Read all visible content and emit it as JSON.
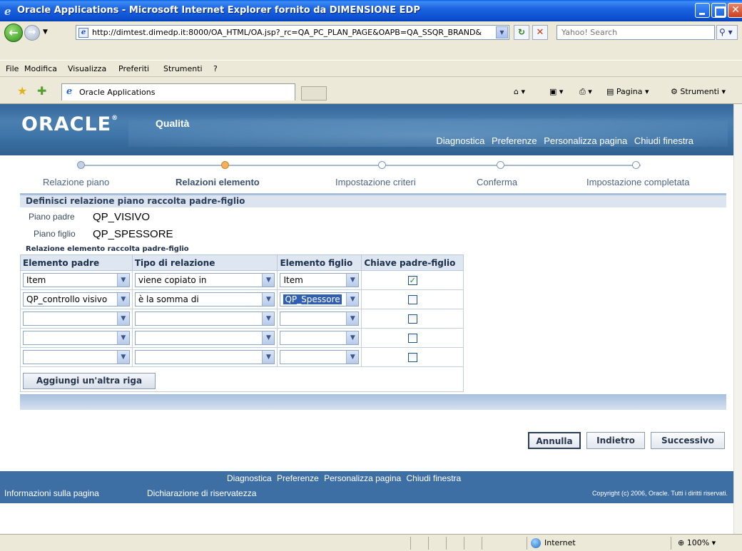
{
  "window": {
    "title": "Oracle Applications - Microsoft Internet Explorer fornito da DIMENSIONE EDP"
  },
  "address": {
    "url": "http://dimtest.dimedp.it:8000/OA_HTML/OA.jsp?_rc=QA_PC_PLAN_PAGE&OAPB=QA_SSQR_BRAND&",
    "search_placeholder": "Yahoo! Search"
  },
  "menu": [
    "File",
    "Modifica",
    "Visualizza",
    "Preferiti",
    "Strumenti",
    "?"
  ],
  "tab": {
    "label": "Oracle Applications"
  },
  "commandbar": {
    "pagina": "Pagina",
    "strumenti": "Strumenti"
  },
  "brand": {
    "oracle": "ORACLE",
    "app": "Qualità"
  },
  "global_links": [
    "Diagnostica",
    "Preferenze",
    "Personalizza pagina",
    "Chiudi finestra"
  ],
  "train": [
    {
      "label": "Relazione piano",
      "state": "done"
    },
    {
      "label": "Relazioni elemento",
      "state": "current"
    },
    {
      "label": "Impostazione criteri",
      "state": "todo"
    },
    {
      "label": "Conferma",
      "state": "todo"
    },
    {
      "label": "Impostazione completata",
      "state": "todo"
    }
  ],
  "section": {
    "header": "Definisci relazione piano raccolta padre-figlio",
    "parent_label": "Piano padre",
    "parent_value": "QP_VISIVO",
    "child_label": "Piano figlio",
    "child_value": "QP_SPESSORE",
    "sub_header": "Relazione elemento raccolta padre-figlio"
  },
  "table": {
    "headers": [
      "Elemento padre",
      "Tipo di relazione",
      "Elemento figlio",
      "Chiave padre-figlio"
    ],
    "rows": [
      {
        "parent": "Item",
        "rel": "viene copiato in",
        "child": "Item",
        "key": true
      },
      {
        "parent": "QP_controllo visivo",
        "rel": "è la somma di",
        "child": "QP_Spessore",
        "key": false
      },
      {
        "parent": "",
        "rel": "",
        "child": "",
        "key": false
      },
      {
        "parent": "",
        "rel": "",
        "child": "",
        "key": false
      },
      {
        "parent": "",
        "rel": "",
        "child": "",
        "key": false
      }
    ],
    "add_row": "Aggiungi un'altra riga"
  },
  "buttons": {
    "cancel": "Annulla",
    "back": "Indietro",
    "next": "Successivo"
  },
  "footer": {
    "links": [
      "Diagnostica",
      "Preferenze",
      "Personalizza pagina",
      "Chiudi finestra"
    ],
    "info": "Informazioni sulla pagina",
    "privacy": "Dichiarazione di riservatezza",
    "copyright": "Copyright (c) 2006, Oracle. Tutti i diritti riservati."
  },
  "statusbar": {
    "zone": "Internet",
    "zoom": "100%"
  }
}
